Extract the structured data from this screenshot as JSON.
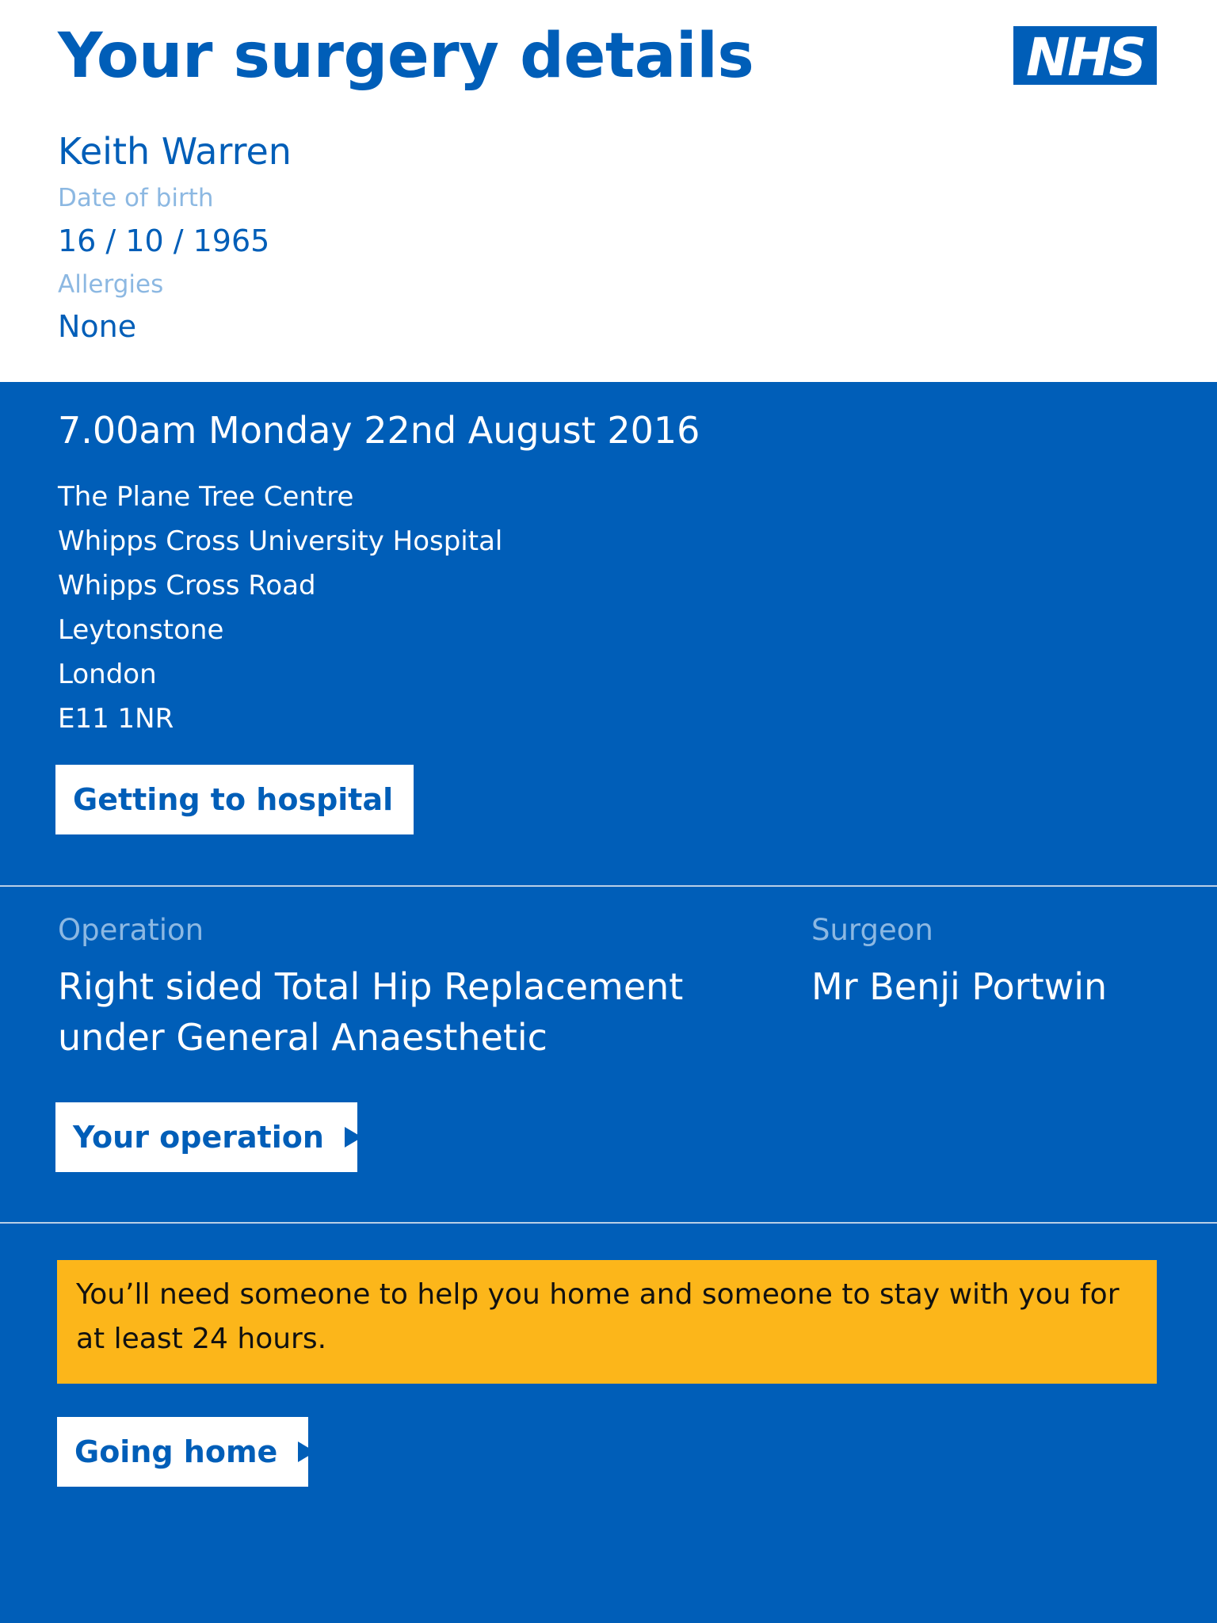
{
  "header": {
    "title": "Your surgery details",
    "logo_text": "NHS"
  },
  "patient": {
    "name": "Keith Warren",
    "dob_label": "Date of birth",
    "dob_value": "16 / 10 / 1965",
    "allergies_label": "Allergies",
    "allergies_value": "None"
  },
  "appointment": {
    "datetime": "7.00am Monday 22nd August 2016",
    "address": [
      "The Plane Tree Centre",
      "Whipps Cross University Hospital",
      "Whipps Cross Road",
      "Leytonstone",
      "London",
      "E11 1NR"
    ],
    "button_label": "Getting to hospital"
  },
  "operation": {
    "label": "Operation",
    "value_line1": "Right sided Total Hip Replacement",
    "value_line2": "under General Anaesthetic",
    "surgeon_label": "Surgeon",
    "surgeon_value": "Mr Benji Portwin",
    "button_label": "Your operation"
  },
  "going_home": {
    "warning": "You’ll need someone to help you home and someone to stay with you for at least 24 hours.",
    "button_label": "Going home"
  },
  "colors": {
    "nhs_blue": "#005eb8",
    "warning_yellow": "#fcb61a",
    "label_light_blue": "#8cb8e2",
    "white": "#ffffff"
  },
  "icons": [
    "nhs-logo",
    "play-arrow-icon"
  ]
}
